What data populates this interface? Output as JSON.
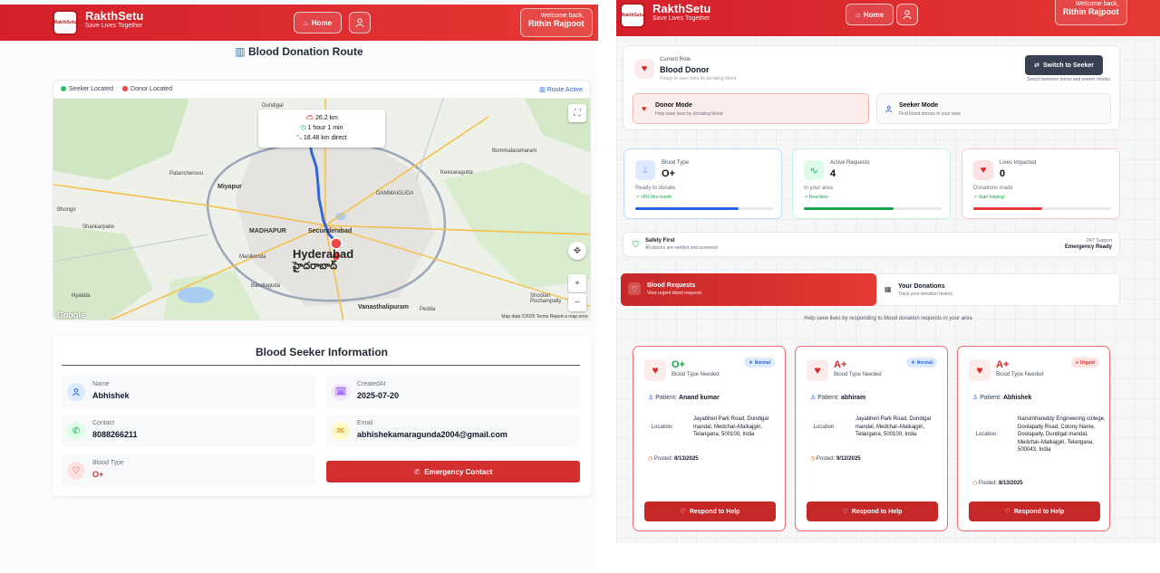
{
  "header": {
    "logo_text": "RakthSetu",
    "brand_title": "RakthSetu",
    "brand_tagline": "Save Lives Together",
    "home_label": "Home",
    "welcome_line": "Welcome back,",
    "user_name": "Rithin Rajpoot"
  },
  "route": {
    "title": "Blood Donation Route",
    "legend_seeker": "Seeker Located",
    "legend_donor": "Donor Located",
    "route_active": "Route Active",
    "distance": "26.2 km",
    "duration": "1 hour 1 min",
    "direct": "18.48 km direct",
    "map_labels": {
      "city": "Hyderabad",
      "city_te": "హైదరాబాద్",
      "secunderabad": "Secunderabad",
      "miyapur": "Miyapur",
      "madhapur": "MADHAPUR",
      "dammaiguda": "DAMMAIGUDA",
      "kompally": "Dundigal",
      "vanasthalipuram": "Vanasthalipuram",
      "manikonda": "Manikonda",
      "keesara": "Keesaragutta",
      "bommalaramaram": "Bommalaramaram",
      "patancheru": "Patancheruvu",
      "shankarpalle": "Shankarpalle",
      "bhongir": "Bhongir",
      "pedda": "Pedda",
      "nyalata": "Nyalata",
      "bandlaguda": "Bandlaguda",
      "shoolan": "Shoolan Pochampally"
    },
    "map_footer": "Map data ©2025   Terms   Report a map error",
    "google": "Google"
  },
  "seeker": {
    "title": "Blood Seeker Information",
    "name_label": "Name",
    "name": "Abhishek",
    "created_label": "CreatedAt",
    "created": "2025-07-20",
    "contact_label": "Contact",
    "contact": "8088266211",
    "email_label": "Email",
    "email": "abhishekamaragunda2004@gmail.com",
    "blood_label": "Blood Type",
    "blood": "O+",
    "emergency_label": "Emergency Contact"
  },
  "role": {
    "current_label": "Current Role",
    "role_name": "Blood Donor",
    "role_desc": "Ready to save lives by donating blood",
    "switch_label": "Switch to Seeker",
    "switch_hint": "Switch between donor and seeker modes",
    "donor_mode_title": "Donor Mode",
    "donor_mode_desc": "Help save lives by donating blood",
    "seeker_mode_title": "Seeker Mode",
    "seeker_mode_desc": "Find blood donors in your area"
  },
  "stats": [
    {
      "label": "Blood Type",
      "value": "O+",
      "sub": "Ready to donate",
      "trend": "+5% this month",
      "fill": 0.75,
      "color": "#2563eb"
    },
    {
      "label": "Active Requests",
      "value": "4",
      "sub": "In your area",
      "trend": "Real-time",
      "fill": 0.65,
      "color": "#16a34a"
    },
    {
      "label": "Lives Impacted",
      "value": "0",
      "sub": "Donations made",
      "trend": "Start helping!",
      "fill": 0.5,
      "color": "#e53935"
    }
  ],
  "safety": {
    "title": "Safety First",
    "desc": "All donors are verified and screened",
    "support": "24/7 Support",
    "ready": "Emergency Ready"
  },
  "tabs": {
    "requests_title": "Blood Requests",
    "requests_desc": "View urgent blood requests",
    "donations_title": "Your Donations",
    "donations_desc": "Track your donation history"
  },
  "help_text": "Help save lives by responding to blood donation requests in your area",
  "requests": [
    {
      "blood": "O+",
      "blood_color": "#16a34a",
      "needed": "Blood Type Needed",
      "badge": "Normal",
      "patient_label": "Patient:",
      "patient": "Anand kumar",
      "location_label": "Location:",
      "location": "Jayabheri Park Road, Dundigal mandal, Medchal–Malkajgiri, Telangana, 500100, India",
      "posted_label": "Posted:",
      "posted": "8/13/2025",
      "respond": "Respond to Help"
    },
    {
      "blood": "A+",
      "blood_color": "#dc2626",
      "needed": "Blood Type Needed",
      "badge": "Normal",
      "patient_label": "Patient:",
      "patient": "abhiram",
      "location_label": "Location:",
      "location": "Jayabheri Park Road, Dundigal mandal, Medchal–Malkajgiri, Telangana, 500100, India",
      "posted_label": "Posted:",
      "posted": "9/12/2025",
      "respond": "Respond to Help"
    },
    {
      "blood": "A+",
      "blood_color": "#dc2626",
      "needed": "Blood Type Needed",
      "badge": "Urgent",
      "patient_label": "Patient:",
      "patient": "Abhishek",
      "location_label": "Location:",
      "location": "Narsimhareddy Engineering college, Doolapally Road, Colony Name, Doolapally, Dundigal mandal, Medchal–Malkajgiri, Telangana, 500043, India",
      "posted_label": "Posted:",
      "posted": "8/13/2025",
      "respond": "Respond to Help"
    }
  ]
}
